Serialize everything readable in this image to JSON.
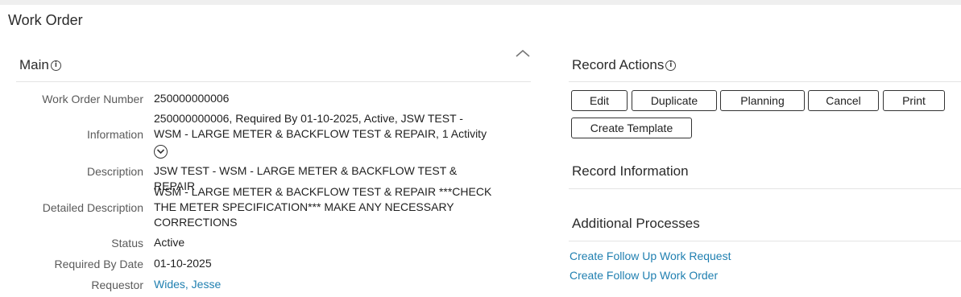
{
  "page": {
    "title": "Work Order"
  },
  "main": {
    "title": "Main",
    "info_icon": "info-icon",
    "collapse_icon": "chevron-up-icon",
    "fields": {
      "work_order_number": {
        "label": "Work Order Number",
        "value": "250000000006"
      },
      "information": {
        "label": "Information",
        "value": "250000000006, Required By 01-10-2025, Active, JSW TEST - WSM - LARGE METER & BACKFLOW TEST & REPAIR, 1 Activity",
        "expand_icon": "chevron-down-circle-icon"
      },
      "description": {
        "label": "Description",
        "value": "JSW TEST - WSM - LARGE METER & BACKFLOW TEST & REPAIR"
      },
      "detailed_description": {
        "label": "Detailed Description",
        "value": "WSM - LARGE METER & BACKFLOW TEST & REPAIR ***CHECK THE METER SPECIFICATION*** MAKE ANY NECESSARY CORRECTIONS"
      },
      "status": {
        "label": "Status",
        "value": "Active"
      },
      "required_by_date": {
        "label": "Required By Date",
        "value": "01-10-2025"
      },
      "requestor": {
        "label": "Requestor",
        "value": "Wides, Jesse"
      }
    }
  },
  "record_actions": {
    "title": "Record Actions",
    "info_icon": "info-icon",
    "buttons": {
      "edit": "Edit",
      "duplicate": "Duplicate",
      "planning": "Planning",
      "cancel": "Cancel",
      "print": "Print",
      "create_template": "Create Template"
    }
  },
  "record_information": {
    "title": "Record Information"
  },
  "additional_processes": {
    "title": "Additional Processes",
    "links": {
      "follow_up_request": "Create Follow Up Work Request",
      "follow_up_order": "Create Follow Up Work Order"
    }
  },
  "colors": {
    "link": "#1f7fb0",
    "label": "#5a5a5a",
    "text": "#1f1f1f"
  }
}
